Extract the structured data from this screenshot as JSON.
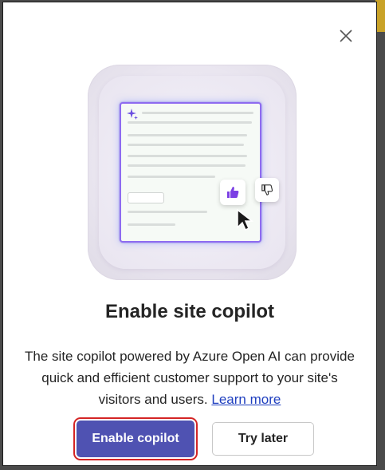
{
  "dialog": {
    "title": "Enable site copilot",
    "description": "The site copilot powered by Azure Open AI can provide quick and efficient customer support to your site's visitors and users.",
    "learn_more": "Learn more",
    "primary_button": "Enable copilot",
    "secondary_button": "Try later",
    "close_icon": "close-icon"
  },
  "illustration": {
    "icons": [
      "sparkle-icon",
      "thumbs-up-icon",
      "thumbs-down-icon",
      "mouse-cursor-icon"
    ]
  },
  "colors": {
    "primary": "#4f52b2",
    "link": "#1f3fbf",
    "focus_outline": "#d42525",
    "card_glow": "#8e6bf0"
  }
}
